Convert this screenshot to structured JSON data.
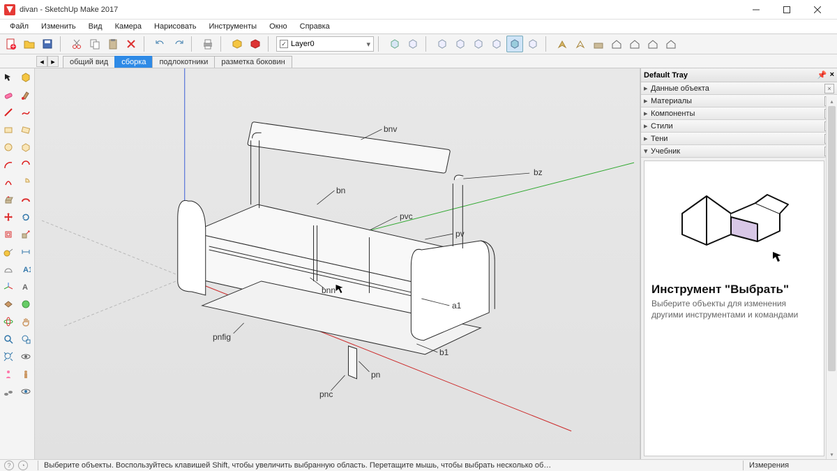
{
  "window": {
    "title": "divan - SketchUp Make 2017"
  },
  "menu": [
    "Файл",
    "Изменить",
    "Вид",
    "Камера",
    "Нарисовать",
    "Инструменты",
    "Окно",
    "Справка"
  ],
  "layer": {
    "current": "Layer0"
  },
  "scenes": {
    "tabs": [
      "общий вид",
      "сборка",
      "подлокотники",
      "разметка боковин"
    ],
    "active_index": 1
  },
  "tray": {
    "title": "Default Tray",
    "panels": [
      {
        "label": "Данные объекта",
        "expanded": false
      },
      {
        "label": "Материалы",
        "expanded": false
      },
      {
        "label": "Компоненты",
        "expanded": false
      },
      {
        "label": "Стили",
        "expanded": false
      },
      {
        "label": "Тени",
        "expanded": false
      },
      {
        "label": "Учебник",
        "expanded": true
      }
    ],
    "instructor": {
      "heading": "Инструмент \"Выбрать\"",
      "body": "Выберите объекты для изменения другими инструментами и командами"
    }
  },
  "status": {
    "hint": "Выберите объекты. Воспользуйтесь клавишей Shift, чтобы увеличить выбранную область. Перетащите мышь, чтобы выбрать несколько об…",
    "measure_label": "Измерения"
  },
  "model_labels": [
    "bnv",
    "bz",
    "bn",
    "pvc",
    "pv",
    "bnn",
    "a1",
    "pnfig",
    "b1",
    "pn",
    "pnc"
  ],
  "icons": {
    "toolbar_main": [
      "new-file",
      "open-file",
      "save",
      "cut",
      "copy",
      "paste",
      "delete",
      "undo",
      "redo",
      "print",
      "component",
      "warehouse"
    ],
    "toolbar_right": [
      "iso",
      "top",
      "front",
      "right",
      "back",
      "left",
      "perspective",
      "zoom-extents",
      "prev",
      "next",
      "shadows",
      "xray",
      "hidden",
      "section",
      "style1",
      "style2"
    ],
    "left_tools": [
      "select",
      "eraser",
      "line",
      "freehand",
      "rectangle",
      "rotated-rect",
      "circle",
      "polygon",
      "arc",
      "two-point-arc",
      "pie",
      "pushpull",
      "offset",
      "move",
      "rotate",
      "scale",
      "followme",
      "tape",
      "protractor",
      "text",
      "dimension",
      "axes",
      "section-plane",
      "paint",
      "orbit",
      "pan",
      "zoom",
      "zoom-window",
      "zoom-extents",
      "walk",
      "look",
      "position-camera",
      "3d-text",
      "sandbox1",
      "sandbox2",
      "add-location",
      "photo-textures",
      "plugin1",
      "plugin2",
      "footprints",
      "icon-x"
    ]
  }
}
